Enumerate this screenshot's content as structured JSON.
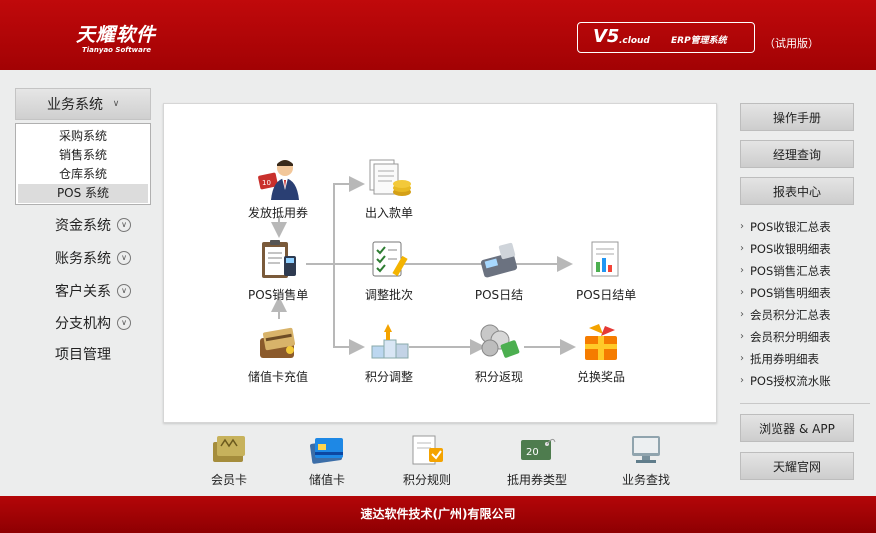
{
  "header": {
    "logo_cn": "天耀软件",
    "logo_en": "Tianyao Software",
    "version": "V5",
    "version_cloud": ".cloud",
    "version_erp": "ERP管理系统",
    "trial": "（试用版）"
  },
  "nav": {
    "head_label": "业务系统",
    "sub_items": [
      {
        "label": "采购系统"
      },
      {
        "label": "销售系统"
      },
      {
        "label": "仓库系统"
      },
      {
        "label": "POS 系统"
      }
    ],
    "items": [
      {
        "label": "资金系统"
      },
      {
        "label": "账务系统"
      },
      {
        "label": "客户关系"
      },
      {
        "label": "分支机构"
      },
      {
        "label": "项目管理"
      }
    ]
  },
  "functions": {
    "issue_voucher": "发放抵用券",
    "in_out": "出入款单",
    "pos_sales": "POS销售单",
    "adjust_batch": "调整批次",
    "pos_daily": "POS日结",
    "pos_daily_sheet": "POS日结单",
    "stored_card_recharge": "储值卡充值",
    "points_adjust": "积分调整",
    "points_return": "积分返现",
    "redeem_prize": "兑换奖品"
  },
  "bottom": {
    "member_card": "会员卡",
    "stored_card": "储值卡",
    "points_rule": "积分规则",
    "voucher_type": "抵用券类型",
    "business_search": "业务查找",
    "voucher_badge": "20"
  },
  "right": {
    "manual": "操作手册",
    "manager_query": "经理查询",
    "report_center": "报表中心",
    "reports": [
      {
        "label": "POS收银汇总表"
      },
      {
        "label": "POS收银明细表"
      },
      {
        "label": "POS销售汇总表"
      },
      {
        "label": "POS销售明细表"
      },
      {
        "label": "会员积分汇总表"
      },
      {
        "label": "会员积分明细表"
      },
      {
        "label": "抵用券明细表"
      },
      {
        "label": "POS授权流水账"
      }
    ],
    "browser_app": "浏览器 & APP",
    "official_site": "天耀官网"
  },
  "footer": {
    "company": "速达软件技术(广州)有限公司"
  },
  "colors": {
    "brand_red": "#b00305",
    "panel_bg": "#ffffff",
    "page_bg": "#eceded"
  }
}
